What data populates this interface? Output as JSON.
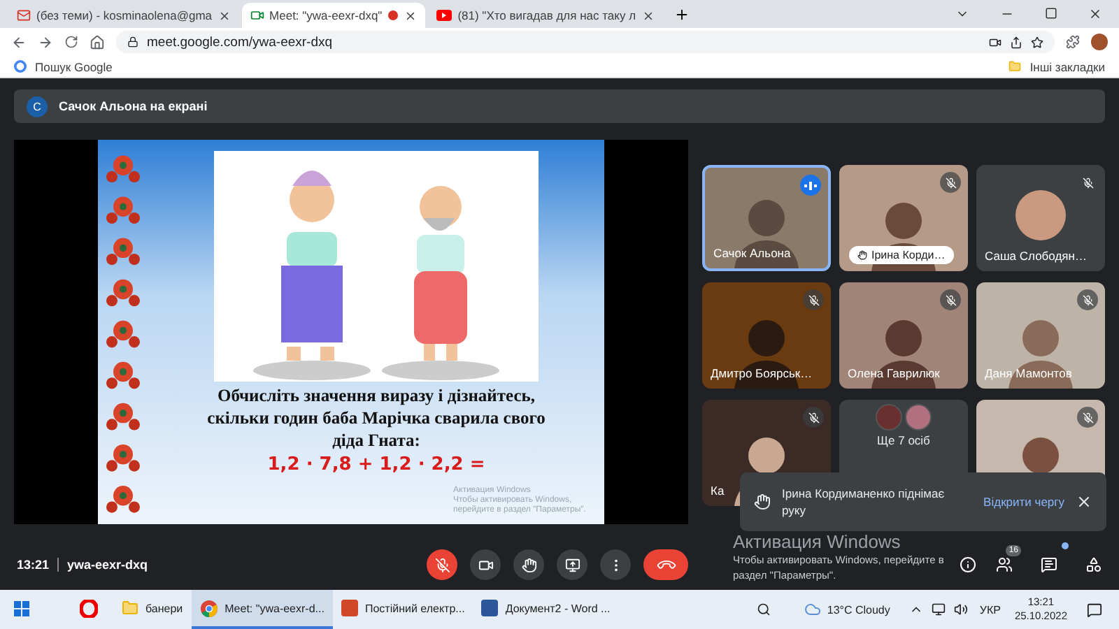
{
  "browser": {
    "tabs": [
      {
        "kind": "mail",
        "title": "(без теми) - kosminaolena@gma",
        "selected": false
      },
      {
        "kind": "meet",
        "title": "Meet: \"ywa-eexr-dxq\"",
        "selected": true,
        "recording": true
      },
      {
        "kind": "video",
        "title": "(81) \"Хто вигадав для нас таку л",
        "selected": false
      }
    ],
    "address": "meet.google.com/ywa-eexr-dxq",
    "bookmarks": {
      "search": "Пошук Google",
      "other": "Інші закладки"
    }
  },
  "meet": {
    "presenter": {
      "initial": "С",
      "text": "Сачок Альона на екрані"
    },
    "slide": {
      "lines": [
        "Обчисліть значення виразу і дізнайтесь,",
        "скільки годин баба Марічка сварила свого",
        "діда Гната:"
      ],
      "expression": "1,2 · 7,8 + 1,2 · 2,2 =",
      "watermark_title": "Активация Windows",
      "watermark_text": "Чтобы активировать Windows, перейдите в раздел \"Параметры\"."
    },
    "tiles": [
      {
        "kind": "video",
        "name": "Сачок Альона",
        "muted": false,
        "speaking": true,
        "hand_raised": false
      },
      {
        "kind": "video",
        "name": "Ірина Корди…",
        "muted": true,
        "speaking": false,
        "hand_raised": true
      },
      {
        "kind": "avatar",
        "name": "Саша Слободян…",
        "muted": true,
        "speaking": false,
        "hand_raised": false
      },
      {
        "kind": "video",
        "name": "Дмитро Боярськ…",
        "muted": true,
        "speaking": false,
        "hand_raised": false
      },
      {
        "kind": "video",
        "name": "Олена Гаврилюк",
        "muted": true,
        "speaking": false,
        "hand_raised": false
      },
      {
        "kind": "video",
        "name": "Даня Мамонтов",
        "muted": true,
        "speaking": false,
        "hand_raised": false
      },
      {
        "kind": "video",
        "name": "Ка",
        "muted": true,
        "speaking": false,
        "hand_raised": false
      },
      {
        "kind": "overflow",
        "name": "Ще 7 осіб",
        "muted": false,
        "speaking": false
      },
      {
        "kind": "video",
        "muted": true,
        "speaking": false
      }
    ],
    "toast": {
      "text": "Ірина Кордиманенко піднімає руку",
      "action": "Відкрити чергу"
    },
    "time": "13:21",
    "code": "ywa-eexr-dxq",
    "controls": {
      "mic_on": false,
      "camera_on": true
    },
    "people_count": "16",
    "chat_unread": true,
    "watermark": {
      "title": "Активация Windows",
      "text": "Чтобы активировать Windows, перейдите в раздел \"Параметры\"."
    }
  },
  "taskbar": {
    "items": [
      {
        "kind": "opera",
        "selected": false
      },
      {
        "kind": "folder",
        "label": "банери",
        "selected": false
      },
      {
        "kind": "chrome",
        "label": "Meet: \"ywa-eexr-d...",
        "selected": true
      },
      {
        "kind": "ppt",
        "label": "Постійний електр...",
        "selected": false
      },
      {
        "kind": "word",
        "label": "Документ2 - Word ...",
        "selected": false
      }
    ],
    "weather": "13°C  Cloudy",
    "lang": "УКР",
    "time": "13:21",
    "date": "25.10.2022"
  }
}
